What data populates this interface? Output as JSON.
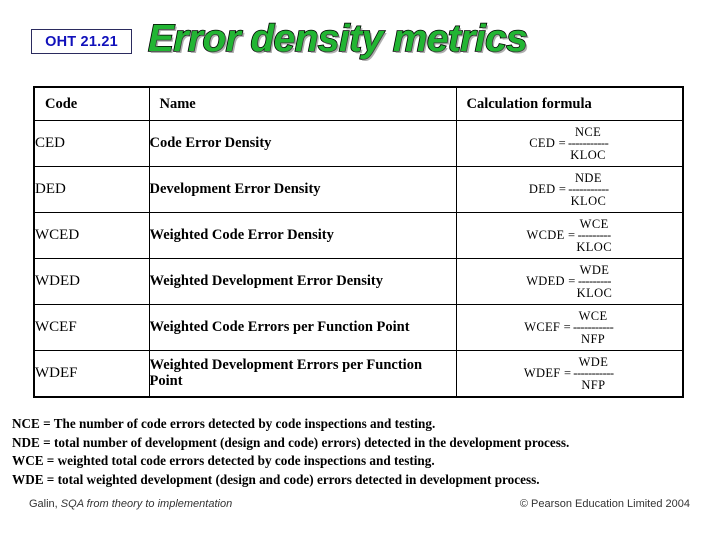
{
  "header": {
    "oht_label": "OHT 21.21",
    "title": "Error density metrics",
    "title_color": "#22b533",
    "oht_color": "#1111bb"
  },
  "table": {
    "header_bg": "#ccffcc",
    "columns": [
      "Code",
      "Name",
      "Calculation formula"
    ],
    "rows": [
      {
        "code": "CED",
        "name": "Code Error Density",
        "formula": {
          "lhs": "CED =",
          "numerator": "NCE",
          "bar": "-----------",
          "denominator": "KLOC"
        }
      },
      {
        "code": "DED",
        "name": "Development Error Density",
        "formula": {
          "lhs": "DED =",
          "numerator": "NDE",
          "bar": "-----------",
          "denominator": "KLOC"
        }
      },
      {
        "code": "WCED",
        "name": "Weighted Code Error Density",
        "formula": {
          "lhs": "WCDE =",
          "numerator": "WCE",
          "bar": "---------",
          "denominator": "KLOC"
        }
      },
      {
        "code": "WDED",
        "name": "Weighted Development Error Density",
        "formula": {
          "lhs": "WDED =",
          "numerator": "WDE",
          "bar": "---------",
          "denominator": "KLOC"
        }
      },
      {
        "code": "WCEF",
        "name": "Weighted Code Errors per Function Point",
        "formula": {
          "lhs": "WCEF =",
          "numerator": "WCE",
          "bar": "-----------",
          "denominator": "NFP"
        }
      },
      {
        "code": "WDEF",
        "name": "Weighted Development Errors per Function Point",
        "formula": {
          "lhs": "WDEF =",
          "numerator": "WDE",
          "bar": "-----------",
          "denominator": "NFP"
        }
      }
    ]
  },
  "notes": [
    "NCE = The number of code errors detected by code inspections and testing.",
    "NDE = total number of development (design and code) errors) detected in the development process.",
    "WCE = weighted total code errors detected by code inspections and testing.",
    "WDE = total weighted development (design and code) errors detected in development process."
  ],
  "footer": {
    "author": "Galin, ",
    "book": "SQA from theory to implementation",
    "copyright": "© Pearson Education Limited 2004"
  }
}
